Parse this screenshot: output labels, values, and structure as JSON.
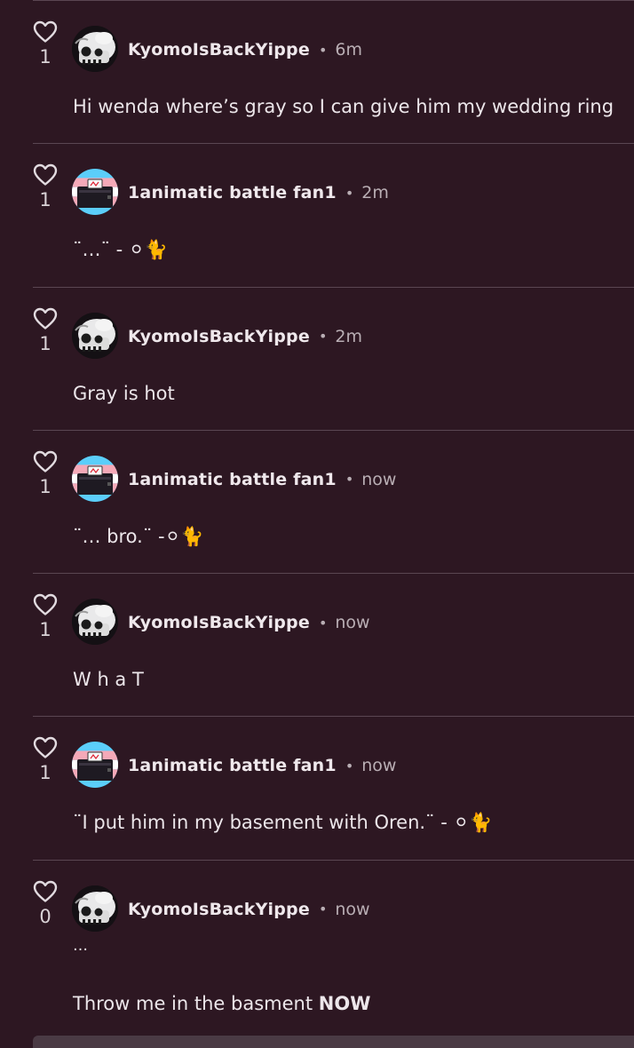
{
  "comments": [
    {
      "likes": "1",
      "author": "KyomoIsBackYippe",
      "separator": "•",
      "time": "6m",
      "avatar": "skull-avatar-icon",
      "text": "Hi wenda where’s gray so I can give him my wedding ring"
    },
    {
      "likes": "1",
      "author": "1animatic battle fan1",
      "separator": "•",
      "time": "2m",
      "avatar": "tv-flag-avatar-icon",
      "text": "¨…¨ - ⚪🐈"
    },
    {
      "likes": "1",
      "author": "KyomoIsBackYippe",
      "separator": "•",
      "time": "2m",
      "avatar": "skull-avatar-icon",
      "text": "Gray is hot"
    },
    {
      "likes": "1",
      "author": "1animatic battle fan1",
      "separator": "•",
      "time": "now",
      "avatar": "tv-flag-avatar-icon",
      "text": "¨… bro.¨ -⚪🐈"
    },
    {
      "likes": "1",
      "author": "KyomoIsBackYippe",
      "separator": "•",
      "time": "now",
      "avatar": "skull-avatar-icon",
      "text": "W h a T"
    },
    {
      "likes": "1",
      "author": "1animatic battle fan1",
      "separator": "•",
      "time": "now",
      "avatar": "tv-flag-avatar-icon",
      "text": "¨I put him in my basement with Oren.¨ - ⚪🐈"
    },
    {
      "likes": "0",
      "author": "KyomoIsBackYippe",
      "separator": "•",
      "time": "now",
      "avatar": "skull-avatar-icon",
      "text_line1": "…",
      "text_prefix": "Throw me in the basment ",
      "text_bold": "NOW"
    }
  ],
  "colors": {
    "background": "#2d1722",
    "divider": "#5a4652",
    "text": "#ece6ea",
    "muted": "#b9aeb4"
  }
}
